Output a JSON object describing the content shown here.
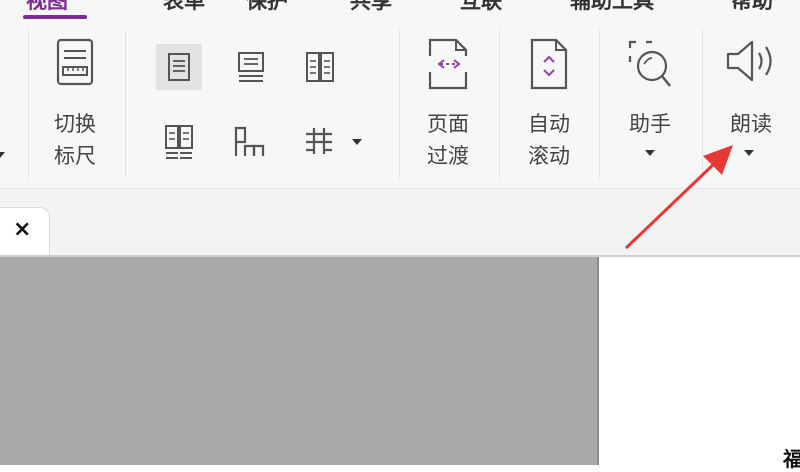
{
  "menu_tabs": [
    {
      "label": "视图",
      "active": true
    },
    {
      "label": "表单",
      "active": false
    },
    {
      "label": "保护",
      "active": false
    },
    {
      "label": "共享",
      "active": false
    },
    {
      "label": "互联",
      "active": false
    },
    {
      "label": "辅助工具",
      "active": false
    },
    {
      "label": "帮助",
      "active": false
    }
  ],
  "ribbon": {
    "ruler_toggle": {
      "label": "切换\n标尺",
      "icon": "ruler-icon"
    },
    "layout_icons": [
      {
        "icon": "single-page-icon",
        "selected": true
      },
      {
        "icon": "continuous-page-icon",
        "selected": false
      },
      {
        "icon": "facing-pages-icon",
        "selected": false
      },
      {
        "icon": "continuous-facing-icon",
        "selected": false
      },
      {
        "icon": "cover-facing-icon",
        "selected": false
      },
      {
        "icon": "split-view-icon",
        "selected": false
      }
    ],
    "page_transition": {
      "label": "页面\n过渡",
      "icon": "page-transition-icon"
    },
    "auto_scroll": {
      "label": "自动\n滚动",
      "icon": "auto-scroll-icon"
    },
    "assistant": {
      "label": "助手",
      "icon": "assistant-icon"
    },
    "read_aloud": {
      "label": "朗读",
      "icon": "speaker-icon"
    }
  },
  "document": {
    "tab_close_symbol": "×",
    "page_text_fragment": "福"
  },
  "colors": {
    "accent": "#7c2e93",
    "annotation_arrow": "#e53935",
    "workspace_gray": "#a9a9a9"
  }
}
